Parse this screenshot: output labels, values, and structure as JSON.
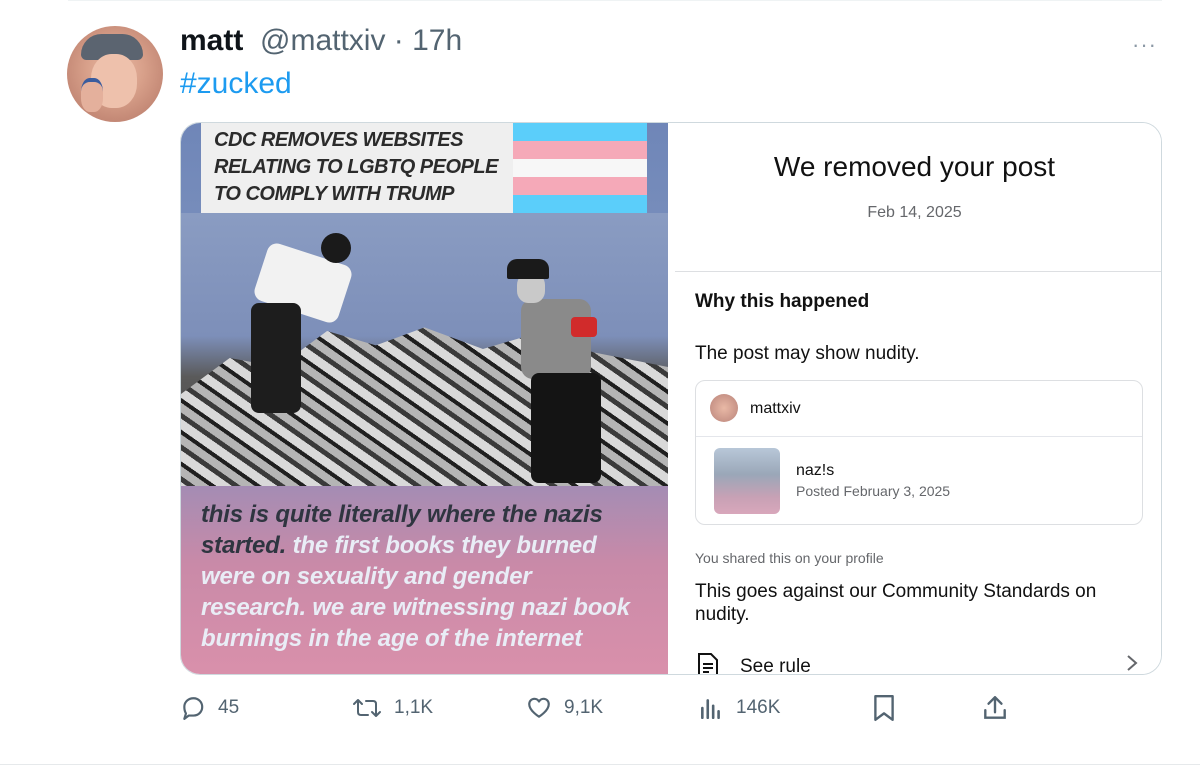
{
  "tweet": {
    "name": "matt",
    "handle_time": "@mattxiv · 17h",
    "hashtag": "#zucked",
    "more": "···"
  },
  "image": {
    "headline": "CDC REMOVES WEBSITES RELATING TO LGBTQ PEOPLE TO COMPLY WITH TRUMP",
    "caption_dark": "this is quite literally where the nazis started.",
    "caption_light": " the first books they burned were on sexuality and gender research. we are witnessing nazi book burnings in the age of the internet"
  },
  "notice": {
    "title": "We removed your post",
    "date": "Feb 14, 2025",
    "why_heading": "Why this happened",
    "reason": "The post may show nudity.",
    "post_user": "mattxiv",
    "post_title": "naz!s",
    "post_date": "Posted February 3, 2025",
    "shared_note": "You shared this on your profile",
    "standards": "This goes against our Community Standards on nudity.",
    "see_rule": "See rule"
  },
  "actions": {
    "replies": "45",
    "reposts": "1,1K",
    "likes": "9,1K",
    "views": "146K"
  },
  "colors": {
    "accent": "#1d9bf0",
    "flag_blue": "#5bcefa",
    "flag_pink": "#f5a9b8",
    "flag_white": "#ffffff"
  }
}
